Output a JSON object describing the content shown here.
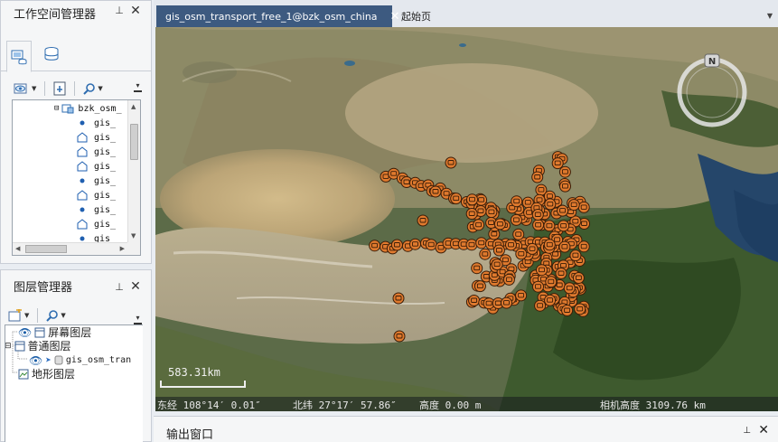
{
  "workspace_panel": {
    "title": "工作空间管理器",
    "pin_glyph": "⊥",
    "close_glyph": "✕",
    "tabs": [
      {
        "icon": "datasource-icon",
        "active": true
      },
      {
        "icon": "database-icon",
        "active": false
      }
    ],
    "tree": {
      "root_label": "bzk_osm_",
      "items": [
        {
          "label": "gis_",
          "icon": "point-icon"
        },
        {
          "label": "gis_",
          "icon": "region-icon"
        },
        {
          "label": "gis_",
          "icon": "region-icon"
        },
        {
          "label": "gis_",
          "icon": "region-icon"
        },
        {
          "label": "gis_",
          "icon": "point-icon"
        },
        {
          "label": "gis_",
          "icon": "region-icon"
        },
        {
          "label": "gis_",
          "icon": "point-icon"
        },
        {
          "label": "gis_",
          "icon": "region-icon"
        },
        {
          "label": "gis_",
          "icon": "point-icon"
        }
      ]
    }
  },
  "layer_panel": {
    "title": "图层管理器",
    "pin_glyph": "⊥",
    "close_glyph": "✕",
    "layers": {
      "screen": "屏幕图层",
      "normal": "普通图层",
      "child": "gis_osm_tran",
      "terrain": "地形图层"
    }
  },
  "tabs": {
    "active_label": "gis_osm_transport_free_1@bzk_osm_china",
    "inactive_label": "起始页",
    "close_glyph": "✕"
  },
  "map": {
    "compass_letter": "N",
    "scale_label": "583.31km",
    "status": {
      "longitude": "东经 108°14′ 0.01″",
      "latitude": "北纬 27°17′ 57.86″",
      "altitude": "高度 0.00 m",
      "camera": "相机高度 3109.76 km"
    },
    "colors": {
      "marker_fill": "#e07a2e",
      "marker_stroke": "#3a1d08",
      "status_bg": "#141a20"
    }
  },
  "output_panel": {
    "title": "输出窗口",
    "pin_glyph": "⊥",
    "close_glyph": "✕"
  }
}
